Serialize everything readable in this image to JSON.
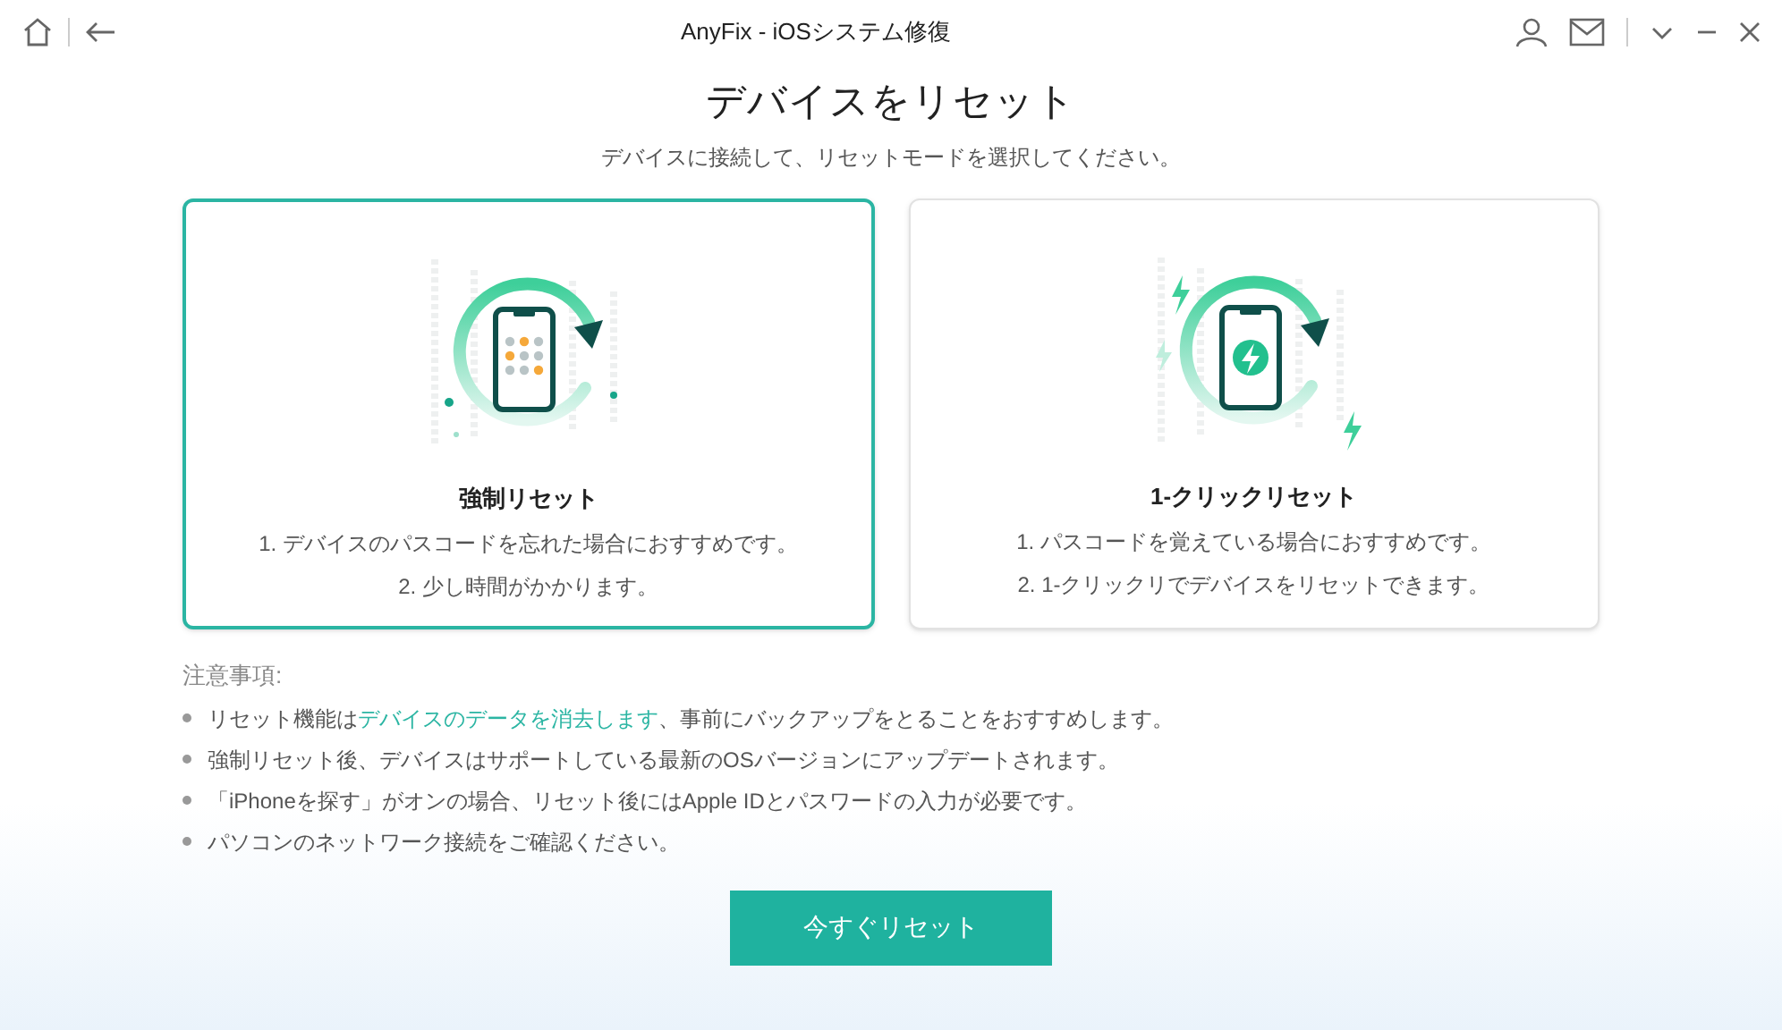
{
  "window": {
    "title": "AnyFix - iOSシステム修復"
  },
  "heading": "デバイスをリセット",
  "subheading": "デバイスに接続して、リセットモードを選択してください。",
  "modes": [
    {
      "kind": "keypad",
      "title": "強制リセット",
      "selected": true,
      "lines": [
        "1. デバイスのパスコードを忘れた場合におすすめです。",
        "2. 少し時間がかかります。"
      ]
    },
    {
      "kind": "bolt",
      "title": "1-クリックリセット",
      "selected": false,
      "lines": [
        "1. パスコードを覚えている場合におすすめです。",
        "2. 1-クリックリでデバイスをリセットできます。"
      ]
    }
  ],
  "notes_title": "注意事項:",
  "notes": [
    {
      "parts": [
        {
          "text": "リセット機能は",
          "link": false
        },
        {
          "text": "デバイスのデータを消去します",
          "link": true
        },
        {
          "text": "、事前にバックアップをとることをおすすめします。",
          "link": false
        }
      ]
    },
    {
      "parts": [
        {
          "text": "強制リセット後、デバイスはサポートしている最新のOSバージョンにアップデートされます。",
          "link": false
        }
      ]
    },
    {
      "parts": [
        {
          "text": "「iPhoneを探す」がオンの場合、リセット後にはApple IDとパスワードの入力が必要です。",
          "link": false
        }
      ]
    },
    {
      "parts": [
        {
          "text": "パソコンのネットワーク接続をご確認ください。",
          "link": false
        }
      ]
    }
  ],
  "action_button": "今すぐリセット"
}
